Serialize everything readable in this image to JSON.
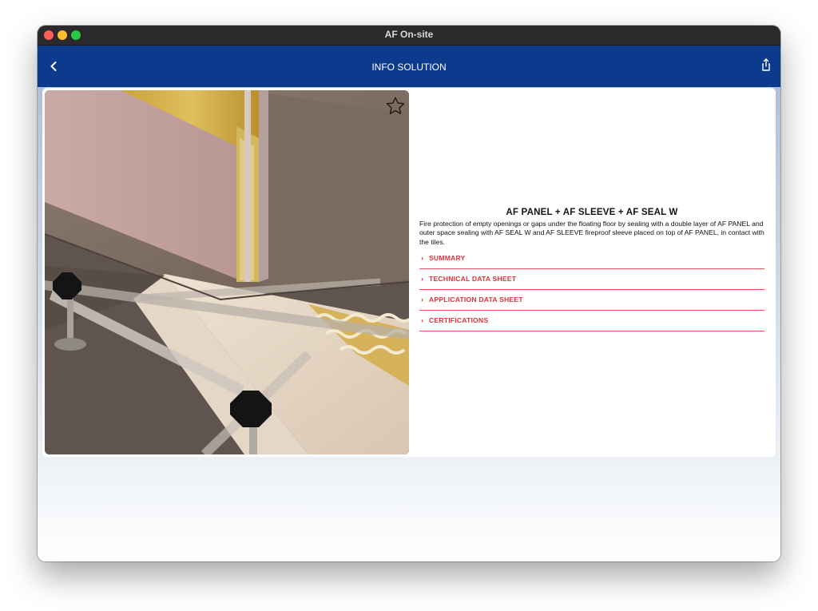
{
  "window": {
    "title": "AF On-site"
  },
  "navbar": {
    "title": "INFO SOLUTION",
    "back_icon": "chevron-left-icon",
    "share_icon": "share-icon",
    "background": "#0c3a8c"
  },
  "product": {
    "favorite_icon": "star-outline-icon",
    "title": "AF PANEL + AF SLEEVE + AF SEAL W",
    "description": "Fire protection of empty openings or gaps under the floating floor by sealing with a double layer of AF PANEL and outer space sealing with AF SEAL W and AF SLEEVE fireproof sleeve placed on top of AF PANEL, in contact with the tiles."
  },
  "sections": [
    {
      "label": "SUMMARY"
    },
    {
      "label": "TECHNICAL DATA SHEET"
    },
    {
      "label": "APPLICATION DATA SHEET"
    },
    {
      "label": "CERTIFICATIONS"
    }
  ],
  "colors": {
    "accent": "#d9343c",
    "divider": "#e9545a"
  }
}
